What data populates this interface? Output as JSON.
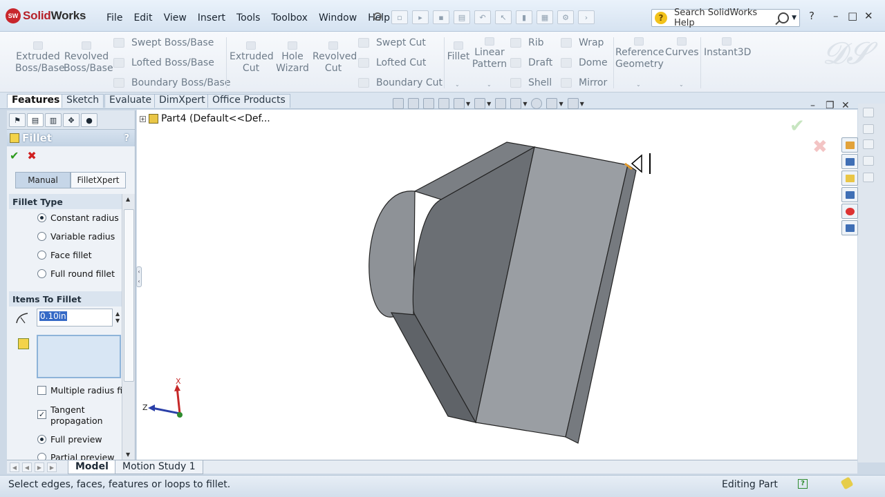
{
  "app": {
    "logo_prefix": "Solid",
    "logo_suffix": "Works",
    "logo_mark": "SW"
  },
  "menu": [
    "File",
    "Edit",
    "View",
    "Insert",
    "Tools",
    "Toolbox",
    "Window",
    "Help"
  ],
  "search": {
    "placeholder": "Search SolidWorks Help"
  },
  "window_controls": {
    "help": "?",
    "minimize": "–",
    "maximize": "□",
    "close": "✕"
  },
  "command_manager": {
    "boss": {
      "extruded": "Extruded\nBoss/Base",
      "revolved": "Revolved\nBoss/Base",
      "swept": "Swept Boss/Base",
      "lofted": "Lofted Boss/Base",
      "boundary": "Boundary Boss/Base"
    },
    "cut": {
      "extruded": "Extruded\nCut",
      "hole": "Hole\nWizard",
      "revolved": "Revolved\nCut",
      "swept": "Swept Cut",
      "lofted": "Lofted Cut",
      "boundary": "Boundary Cut"
    },
    "features": {
      "fillet": "Fillet",
      "linear_pattern": "Linear\nPattern",
      "rib": "Rib",
      "draft": "Draft",
      "shell": "Shell",
      "wrap": "Wrap",
      "dome": "Dome",
      "mirror": "Mirror",
      "reference_geometry": "Reference\nGeometry",
      "curves": "Curves",
      "instant3d": "Instant3D"
    }
  },
  "tabs": [
    "Features",
    "Sketch",
    "Evaluate",
    "DimXpert",
    "Office Products"
  ],
  "property_manager": {
    "title": "Fillet",
    "help": "?",
    "ok": "✔",
    "cancel": "✖",
    "modes": [
      "Manual",
      "FilletXpert"
    ],
    "fillet_type": {
      "heading": "Fillet Type",
      "options": [
        "Constant radius",
        "Variable radius",
        "Face fillet",
        "Full round fillet"
      ],
      "selected_index": 0
    },
    "items_to_fillet": {
      "heading": "Items To Fillet",
      "radius": "0.10in",
      "multiple_radius": "Multiple radius fillet",
      "tangent_propagation": "Tangent propagation",
      "tangent_checked": true,
      "full_preview": "Full preview",
      "partial_preview": "Partial preview"
    }
  },
  "feature_tree": {
    "root": "Part4  (Default<<Def..."
  },
  "triad": {
    "x": "X",
    "z": "Z"
  },
  "bottom_tabs": [
    "Model",
    "Motion Study 1"
  ],
  "status": {
    "message": "Select edges, faces, features or loops to fillet.",
    "mode": "Editing Part",
    "help": "?"
  },
  "colors": {
    "accent": "#3569c6",
    "ok_green": "#2c9a1e",
    "cancel_red": "#d02020",
    "model_face_dark": "#6f7377",
    "model_face_light": "#9a9ea3"
  }
}
